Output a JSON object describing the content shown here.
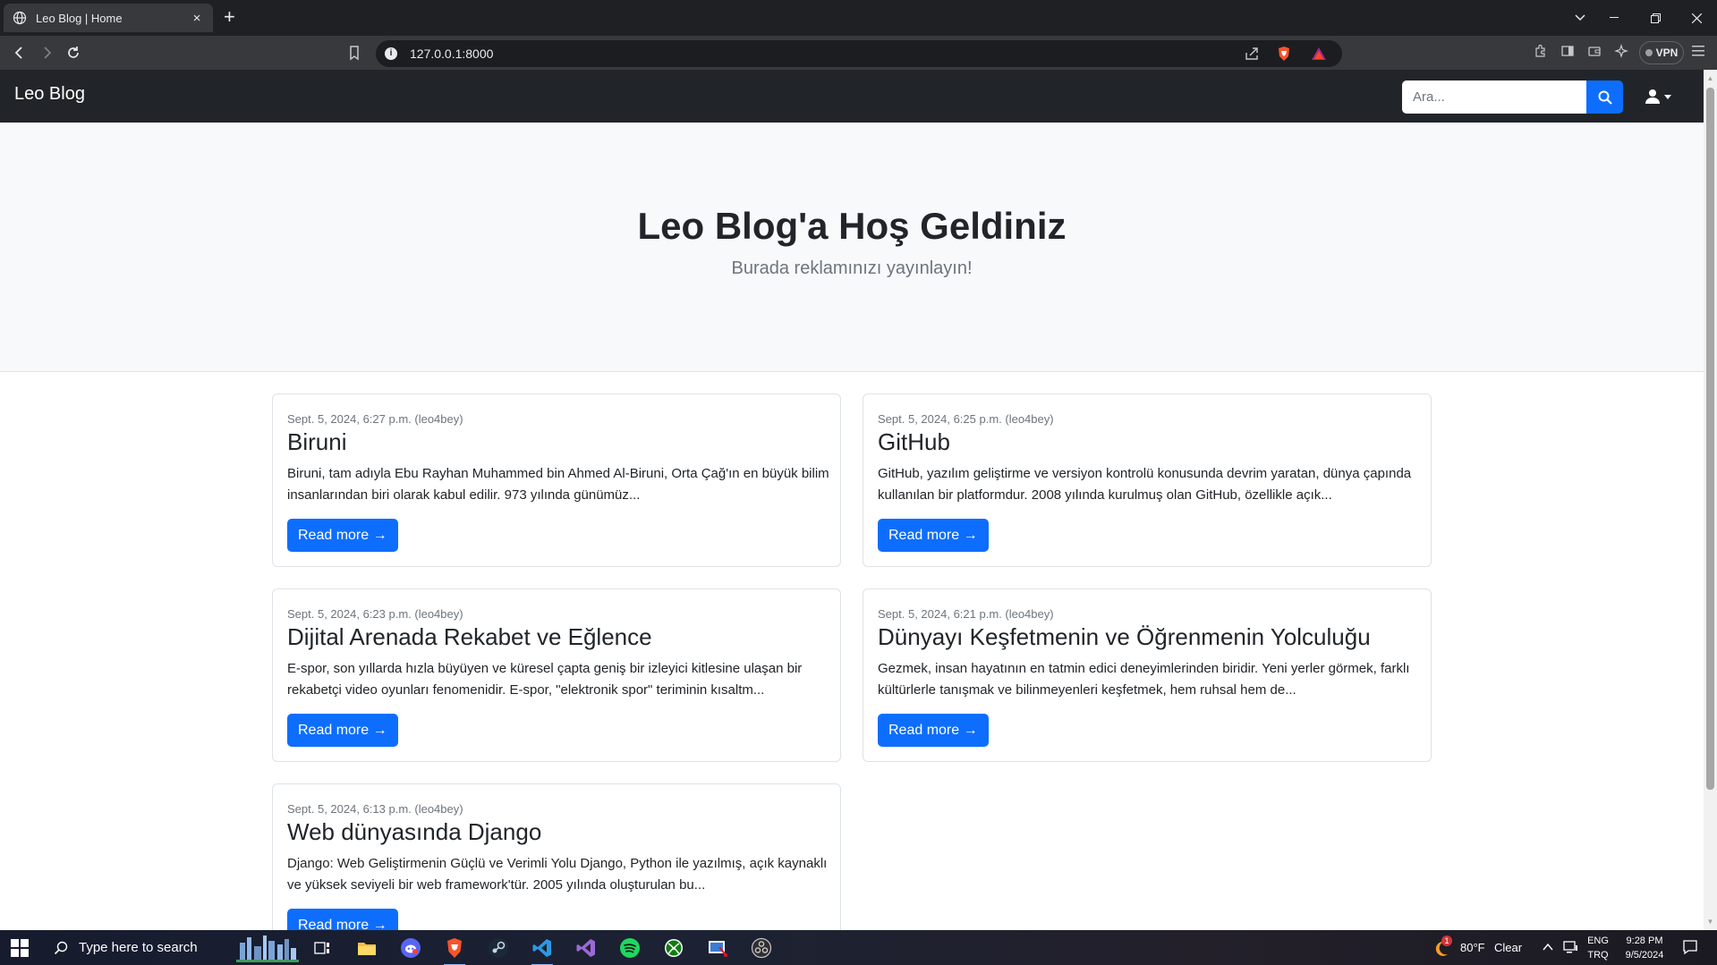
{
  "browser": {
    "tab_title": "Leo Blog | Home",
    "tab_close": "×",
    "new_tab": "+",
    "url": "127.0.0.1:8000",
    "vpn_label": "VPN"
  },
  "site": {
    "brand": "Leo Blog",
    "search_placeholder": "Ara...",
    "hero_title": "Leo Blog'a Hoş Geldiniz",
    "hero_lead": "Burada reklamınızı yayınlayın!",
    "read_more_label": "Read more →"
  },
  "posts": [
    {
      "meta": "Sept. 5, 2024, 6:27 p.m. (leo4bey)",
      "title": "Biruni",
      "excerpt": "Biruni, tam adıyla Ebu Rayhan Muhammed bin Ahmed Al-Biruni, Orta Çağ'ın en büyük bilim insanlarından biri olarak kabul edilir. 973 yılında günümüz...",
      "button": "Read more →"
    },
    {
      "meta": "Sept. 5, 2024, 6:25 p.m. (leo4bey)",
      "title": "GitHub",
      "excerpt": "GitHub, yazılım geliştirme ve versiyon kontrolü konusunda devrim yaratan, dünya çapında kullanılan bir platformdur. 2008 yılında kurulmuş olan GitHub, özellikle açık...",
      "button": "Read more →"
    },
    {
      "meta": "Sept. 5, 2024, 6:23 p.m. (leo4bey)",
      "title": "Dijital Arenada Rekabet ve Eğlence",
      "excerpt": "E-spor, son yıllarda hızla büyüyen ve küresel çapta geniş bir izleyici kitlesine ulaşan bir rekabetçi video oyunları fenomenidir. E-spor, \"elektronik spor\" teriminin kısaltm...",
      "button": "Read more →"
    },
    {
      "meta": "Sept. 5, 2024, 6:21 p.m. (leo4bey)",
      "title": "Dünyayı Keşfetmenin ve Öğrenmenin Yolculuğu",
      "excerpt": "Gezmek, insan hayatının en tatmin edici deneyimlerinden biridir. Yeni yerler görmek, farklı kültürlerle tanışmak ve bilinmeyenleri keşfetmek, hem ruhsal hem de...",
      "button": "Read more →"
    },
    {
      "meta": "Sept. 5, 2024, 6:13 p.m. (leo4bey)",
      "title": "Web dünyasında Django",
      "excerpt": "Django: Web Geliştirmenin Güçlü ve Verimli Yolu Django, Python ile yazılmış, açık kaynaklı ve yüksek seviyeli bir web framework'tür. 2005 yılında oluşturulan bu...",
      "button": "Read more →"
    }
  ],
  "taskbar": {
    "search_text": "Type here to search",
    "weather_temp": "80°F",
    "weather_desc": "Clear",
    "weather_badge": "1",
    "lang_1": "ENG",
    "lang_2": "TRQ",
    "time": "9:28 PM",
    "date": "9/5/2024"
  },
  "colors": {
    "navbar_bg": "#212529",
    "primary": "#0d6efd",
    "hero_bg": "#f8f9fa"
  }
}
